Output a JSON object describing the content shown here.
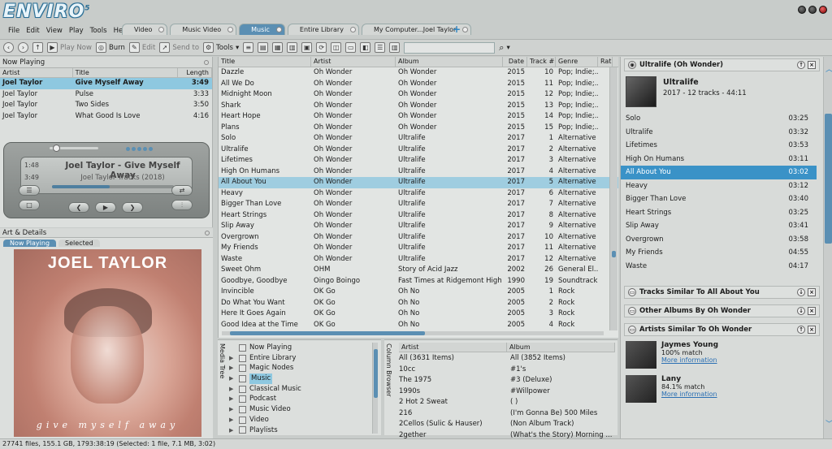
{
  "app": {
    "logo": "ENVIRO",
    "logo_mark": "5"
  },
  "menu": [
    "File",
    "Edit",
    "View",
    "Play",
    "Tools",
    "Help"
  ],
  "tabs": [
    {
      "label": "Video",
      "active": false
    },
    {
      "label": "Music Video",
      "active": false
    },
    {
      "label": "Music",
      "active": true
    },
    {
      "label": "Entire Library",
      "active": false
    },
    {
      "label": "My Computer...Joel Taylor",
      "active": false
    }
  ],
  "tabs_add": "+",
  "toolbar": {
    "play_now": "Play Now",
    "burn": "Burn",
    "edit": "Edit",
    "send_to": "Send to",
    "tools": "Tools"
  },
  "now_playing": {
    "title": "Now Playing",
    "columns": [
      "Artist",
      "Title",
      "Length"
    ],
    "rows": [
      {
        "artist": "Joel Taylor",
        "title": "Give Myself Away",
        "length": "3:49",
        "selected": true
      },
      {
        "artist": "Joel Taylor",
        "title": "Pulse",
        "length": "3:33"
      },
      {
        "artist": "Joel Taylor",
        "title": "Two Sides",
        "length": "3:50"
      },
      {
        "artist": "Joel Taylor",
        "title": "What Good Is Love",
        "length": "4:16"
      }
    ]
  },
  "player": {
    "elapsed": "1:48",
    "total": "3:49",
    "track": "Joel Taylor - Give Myself Away",
    "album": "Joel Taylor Tracks (2018)",
    "progress": 0.47
  },
  "art": {
    "title": "Art & Details",
    "tab_now": "Now Playing",
    "tab_selected": "Selected",
    "cover_text": "JOEL TAYLOR",
    "cover_sub": "give myself away"
  },
  "library": {
    "columns": [
      "Title",
      "Artist",
      "Album",
      "Date",
      "Track #",
      "Genre",
      "Rati"
    ],
    "rows": [
      [
        "Dazzle",
        "Oh Wonder",
        "Oh Wonder",
        "2015",
        "10",
        "Pop; Indie;..."
      ],
      [
        "All We Do",
        "Oh Wonder",
        "Oh Wonder",
        "2015",
        "11",
        "Pop; Indie;..."
      ],
      [
        "Midnight Moon",
        "Oh Wonder",
        "Oh Wonder",
        "2015",
        "12",
        "Pop; Indie;..."
      ],
      [
        "Shark",
        "Oh Wonder",
        "Oh Wonder",
        "2015",
        "13",
        "Pop; Indie;..."
      ],
      [
        "Heart Hope",
        "Oh Wonder",
        "Oh Wonder",
        "2015",
        "14",
        "Pop; Indie;..."
      ],
      [
        "Plans",
        "Oh Wonder",
        "Oh Wonder",
        "2015",
        "15",
        "Pop; Indie;..."
      ],
      [
        "Solo",
        "Oh Wonder",
        "Ultralife",
        "2017",
        "1",
        "Alternative"
      ],
      [
        "Ultralife",
        "Oh Wonder",
        "Ultralife",
        "2017",
        "2",
        "Alternative"
      ],
      [
        "Lifetimes",
        "Oh Wonder",
        "Ultralife",
        "2017",
        "3",
        "Alternative"
      ],
      [
        "High On Humans",
        "Oh Wonder",
        "Ultralife",
        "2017",
        "4",
        "Alternative"
      ],
      [
        "All About You",
        "Oh Wonder",
        "Ultralife",
        "2017",
        "5",
        "Alternative"
      ],
      [
        "Heavy",
        "Oh Wonder",
        "Ultralife",
        "2017",
        "6",
        "Alternative"
      ],
      [
        "Bigger Than Love",
        "Oh Wonder",
        "Ultralife",
        "2017",
        "7",
        "Alternative"
      ],
      [
        "Heart Strings",
        "Oh Wonder",
        "Ultralife",
        "2017",
        "8",
        "Alternative"
      ],
      [
        "Slip Away",
        "Oh Wonder",
        "Ultralife",
        "2017",
        "9",
        "Alternative"
      ],
      [
        "Overgrown",
        "Oh Wonder",
        "Ultralife",
        "2017",
        "10",
        "Alternative"
      ],
      [
        "My Friends",
        "Oh Wonder",
        "Ultralife",
        "2017",
        "11",
        "Alternative"
      ],
      [
        "Waste",
        "Oh Wonder",
        "Ultralife",
        "2017",
        "12",
        "Alternative"
      ],
      [
        "Sweet Ohm",
        "OHM",
        "Story of Acid Jazz",
        "2002",
        "26",
        "General El..."
      ],
      [
        "Goodbye, Goodbye",
        "Oingo Boingo",
        "Fast Times at Ridgemont High",
        "1990",
        "19",
        "Soundtrack"
      ],
      [
        "Invincible",
        "OK Go",
        "Oh No",
        "2005",
        "1",
        "Rock"
      ],
      [
        "Do What You Want",
        "OK Go",
        "Oh No",
        "2005",
        "2",
        "Rock"
      ],
      [
        "Here It Goes Again",
        "OK Go",
        "Oh No",
        "2005",
        "3",
        "Rock"
      ],
      [
        "Good Idea at the Time",
        "OK Go",
        "Oh No",
        "2005",
        "4",
        "Rock"
      ]
    ],
    "selected_index": 10
  },
  "tree": {
    "title": "Media Tree",
    "items": [
      "Now Playing",
      "Entire Library",
      "Magic Nodes",
      "Music",
      "Classical Music",
      "Podcast",
      "Music Video",
      "Video",
      "Playlists"
    ],
    "selected": "Music"
  },
  "browser": {
    "title": "Column Browser",
    "artist_header": "Artist",
    "album_header": "Album",
    "artists": [
      "All (3631 Items)",
      "10cc",
      "The 1975",
      "1990s",
      "2 Hot 2 Sweat",
      "216",
      "2Cellos (Sulic & Hauser)",
      "2gether"
    ],
    "albums": [
      "All (3852 Items)",
      "#1's",
      "#3 (Deluxe)",
      "#Willpower",
      "( )",
      "(I'm Gonna Be) 500 Miles",
      "(Non Album Track)",
      "(What's the Story) Morning ..."
    ]
  },
  "right": {
    "album_panel_title": "Ultralife (Oh Wonder)",
    "album_name": "Ultralife",
    "album_info": "2017 - 12 tracks - 44:11",
    "tracks": [
      [
        "Solo",
        "03:25"
      ],
      [
        "Ultralife",
        "03:32"
      ],
      [
        "Lifetimes",
        "03:53"
      ],
      [
        "High On Humans",
        "03:11"
      ],
      [
        "All About You",
        "03:02"
      ],
      [
        "Heavy",
        "03:12"
      ],
      [
        "Bigger Than Love",
        "03:40"
      ],
      [
        "Heart Strings",
        "03:25"
      ],
      [
        "Slip Away",
        "03:41"
      ],
      [
        "Overgrown",
        "03:58"
      ],
      [
        "My Friends",
        "04:55"
      ],
      [
        "Waste",
        "04:17"
      ]
    ],
    "selected_track": 4,
    "similar_tracks_title": "Tracks Similar To All About You",
    "other_albums_title": "Other Albums By Oh Wonder",
    "similar_artists_title": "Artists Similar To Oh Wonder",
    "artists": [
      {
        "name": "Jaymes Young",
        "match": "100% match",
        "link": "More information"
      },
      {
        "name": "Lany",
        "match": "84.1% match",
        "link": "More information"
      }
    ]
  },
  "status": "27741 files, 155.1 GB, 1793:38:19 (Selected: 1 file, 7.1 MB, 3:02)"
}
